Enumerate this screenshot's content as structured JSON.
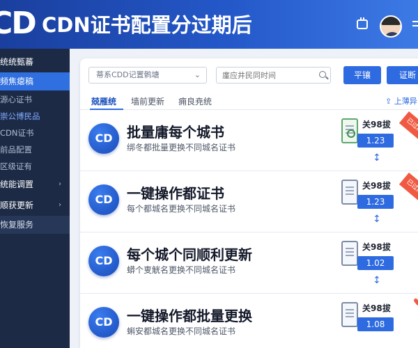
{
  "header": {
    "logo_text": "CD",
    "title": "CDN证书配置分过期后",
    "calendar_icon": "calendar-icon",
    "avatar_icon": "user-avatar",
    "menu_icon": "menu-icon"
  },
  "sidebar": {
    "items": [
      {
        "label": "统统甄蕃",
        "kind": "head"
      },
      {
        "label": "频焦瘪稿",
        "kind": "active"
      },
      {
        "label": "源心证书",
        "kind": "sub"
      },
      {
        "label": "崇公博民品",
        "kind": "sub-hl"
      },
      {
        "label": "CDN证书",
        "kind": "sub"
      },
      {
        "label": "前品配置",
        "kind": "sub"
      },
      {
        "label": "区级证有",
        "kind": "sub"
      },
      {
        "label": "统能调置",
        "kind": "head",
        "chevron": "›"
      },
      {
        "label": "顺获更新",
        "kind": "head",
        "chevron": "›"
      },
      {
        "label": "恢复服务",
        "kind": "section"
      }
    ]
  },
  "toolbar": {
    "select_value": "蒂系CDD记置鹘塘",
    "search_placeholder": "廑应井民同时间",
    "button1_label": "平镶",
    "button2_label": "证断"
  },
  "tabs": {
    "items": [
      "兢雁统",
      "墙前更新",
      "痈良尭统"
    ],
    "right_action": "上薄异"
  },
  "cards": [
    {
      "badge": "CD",
      "title": "批量庸每个城书",
      "desc": "绑冬都批量更换不同城名证书",
      "expiry_label": "关98拔",
      "version": "1.23",
      "doc_style": "green",
      "ribbon": "已过期"
    },
    {
      "badge": "CD",
      "title": "一键操作都证书",
      "desc": "每个都城名更换不同城名证书",
      "expiry_label": "关98拔",
      "version": "1.23",
      "doc_style": "plain",
      "ribbon": "已过期"
    },
    {
      "badge": "CD",
      "title": "每个城个同顺利更新",
      "desc": "蟒个叓觥名更换不同城名证书",
      "expiry_label": "关98拔",
      "version": "1.02",
      "doc_style": "plain",
      "ribbon": ""
    },
    {
      "badge": "CD",
      "title": "一键操作都批量更换",
      "desc": "蝌安都城名更换不同城名证书",
      "expiry_label": "关98拔",
      "version": "1.08",
      "doc_style": "plain",
      "ribbon": ""
    }
  ],
  "colors": {
    "header_start": "#1a3f9e",
    "header_end": "#3d7ae6",
    "sidebar_bg": "#1c2a45",
    "accent": "#2e6be0",
    "ribbon": "#f05a43"
  }
}
